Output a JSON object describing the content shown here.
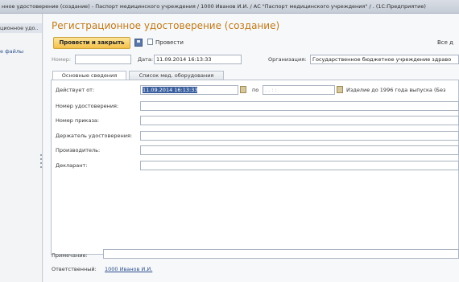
{
  "window": {
    "title": "нное удостоверение (создание) - Паспорт медицинского учреждения / 1000 Иванов И.И. / АС \"Паспорт медицинского учреждения\" / . (1С:Предприятие)"
  },
  "sidebar": {
    "items": [
      {
        "label": "ционное удо..."
      },
      {
        "label": "е файлы"
      }
    ]
  },
  "form": {
    "title": "Регистрационное удостоверение (создание)",
    "toolbar": {
      "post_and_close": "Провести и закрыть",
      "post": "Провести",
      "all_actions": "Все д"
    },
    "header": {
      "number_label": "Номер:",
      "number_value": "",
      "date_label": "Дата:",
      "date_value": "11.09.2014 16:13:33",
      "org_label": "Организация:",
      "org_value": "Государственное бюджетное учреждение здраво"
    },
    "tabs": [
      {
        "label": "Основные сведения"
      },
      {
        "label": "Список мед. оборудования"
      }
    ],
    "main_tab": {
      "valid_from_label": "Действует от:",
      "valid_from_value": "11.09.2014 16:13:33",
      "to_label": "по",
      "to_value": ". . :  :",
      "pre1996_label": "Изделие до 1996 года выпуска (Без",
      "cert_number_label": "Номер удостоверения:",
      "order_number_label": "Номер приказа:",
      "holder_label": "Держатель удостоверения:",
      "manufacturer_label": "Производитель:",
      "declarant_label": "Декларант:"
    },
    "footer": {
      "note_label": "Примечание:",
      "note_value": "",
      "responsible_label": "Ответственный:",
      "responsible_value": "1000 Иванов И.И."
    }
  }
}
